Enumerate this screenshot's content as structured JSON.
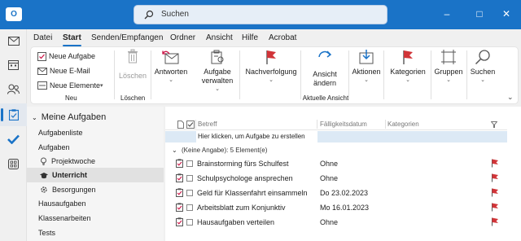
{
  "window": {
    "search_placeholder": "Suchen",
    "accent": "#1a73c7"
  },
  "rail": [
    "mail-icon",
    "calendar-icon",
    "people-icon",
    "tasks-icon",
    "todo-check-icon",
    "apps-icon"
  ],
  "menu": {
    "tabs": [
      "Datei",
      "Start",
      "Senden/Empfangen",
      "Ordner",
      "Ansicht",
      "Hilfe",
      "Acrobat"
    ],
    "active": "Start"
  },
  "ribbon": {
    "neu": {
      "new_task": "Neue Aufgabe",
      "new_email": "Neue E-Mail",
      "new_items": "Neue Elemente",
      "label": "Neu"
    },
    "loeschen": {
      "delete": "Löschen",
      "label": "Löschen"
    },
    "reply": "Antworten",
    "manage_task_1": "Aufgabe",
    "manage_task_2": "verwalten",
    "followup": "Nachverfolgung",
    "change_view_1": "Ansicht",
    "change_view_2": "ändern",
    "current_view_label": "Aktuelle Ansicht",
    "actions": "Aktionen",
    "categories": "Kategorien",
    "groups": "Gruppen",
    "search": "Suchen"
  },
  "nav": {
    "header": "Meine Aufgaben",
    "items": [
      {
        "label": "Aufgabenliste",
        "indent": 0
      },
      {
        "label": "Aufgaben",
        "indent": 0
      },
      {
        "label": "Projektwoche",
        "indent": 1,
        "icon": "lightbulb-icon"
      },
      {
        "label": "Unterricht",
        "indent": 1,
        "icon": "graduation-cap-icon",
        "selected": true
      },
      {
        "label": "Besorgungen",
        "indent": 1,
        "icon": "gear-icon"
      },
      {
        "label": "Hausaufgaben",
        "indent": 0
      },
      {
        "label": "Klassenarbeiten",
        "indent": 0
      },
      {
        "label": "Tests",
        "indent": 0
      }
    ]
  },
  "list": {
    "columns": {
      "subject": "Betreff",
      "due": "Fälligkeitsdatum",
      "categories": "Kategorien"
    },
    "new_task_placeholder": "Hier klicken, um Aufgabe zu erstellen",
    "group_label": "(Keine Angabe): 5 Element(e)",
    "flag_color": "#d13438",
    "tasks": [
      {
        "subject": "Brainstorming fürs Schulfest",
        "due": "Ohne"
      },
      {
        "subject": "Schulpsychologe ansprechen",
        "due": "Ohne"
      },
      {
        "subject": "Geld für Klassenfahrt einsammeln",
        "due": "Do 23.02.2023"
      },
      {
        "subject": "Arbeitsblatt zum Konjunktiv",
        "due": "Mo 16.01.2023"
      },
      {
        "subject": "Hausaufgaben verteilen",
        "due": "Ohne"
      }
    ]
  }
}
